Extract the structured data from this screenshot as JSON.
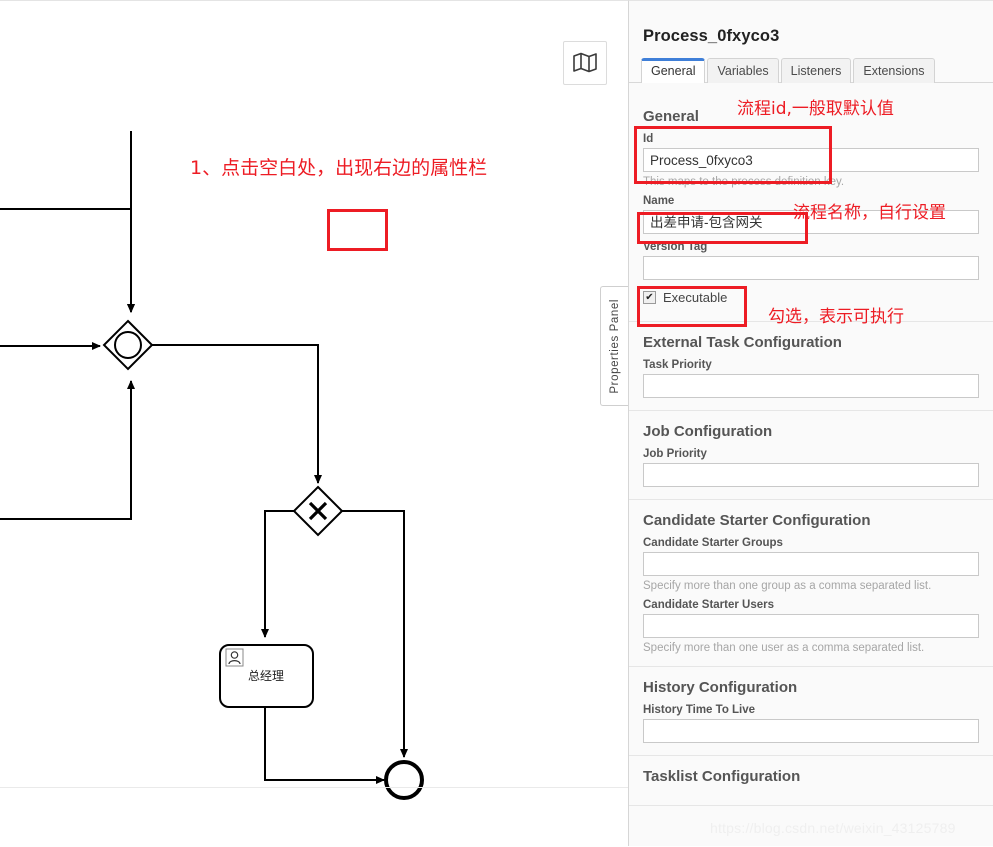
{
  "canvas": {
    "minimap_icon": "map-icon",
    "panel_handle_label": "Properties Panel",
    "annotation_step1": "1、点击空白处，出现右边的属性栏",
    "task_label": "总经理",
    "task_icon": "user-icon",
    "gateway_inclusive_icon": "inclusive-gateway-icon",
    "gateway_exclusive_icon": "exclusive-gateway-icon",
    "end_event_icon": "end-event-icon"
  },
  "panel": {
    "title": "Process_0fxyco3",
    "tabs": [
      {
        "label": "General",
        "active": true
      },
      {
        "label": "Variables",
        "active": false
      },
      {
        "label": "Listeners",
        "active": false
      },
      {
        "label": "Extensions",
        "active": false
      }
    ],
    "general": {
      "heading": "General",
      "id_label": "Id",
      "id_value": "Process_0fxyco3",
      "id_hint": "This maps to the process definition key.",
      "name_label": "Name",
      "name_value": "出差申请-包含网关",
      "version_tag_label": "Version Tag",
      "version_tag_value": "",
      "executable_label": "Executable",
      "executable_checked": true,
      "check_glyph": "✔"
    },
    "external_task": {
      "heading": "External Task Configuration",
      "task_priority_label": "Task Priority",
      "task_priority_value": ""
    },
    "job": {
      "heading": "Job Configuration",
      "job_priority_label": "Job Priority",
      "job_priority_value": ""
    },
    "candidate_starter": {
      "heading": "Candidate Starter Configuration",
      "groups_label": "Candidate Starter Groups",
      "groups_value": "",
      "groups_hint": "Specify more than one group as a comma separated list.",
      "users_label": "Candidate Starter Users",
      "users_value": "",
      "users_hint": "Specify more than one user as a comma separated list."
    },
    "history": {
      "heading": "History Configuration",
      "ttl_label": "History Time To Live",
      "ttl_value": ""
    },
    "tasklist": {
      "heading": "Tasklist Configuration"
    }
  },
  "annotations": {
    "id_note": "流程id,一般取默认值",
    "name_note": "流程名称，自行设置",
    "executable_note": "勾选，表示可执行"
  },
  "watermark": "https://blog.csdn.net/weixin_43125789",
  "colors": {
    "annotation_red": "#ed1c24",
    "tab_active": "#3f7fd8",
    "panel_bg": "#fafafa"
  }
}
